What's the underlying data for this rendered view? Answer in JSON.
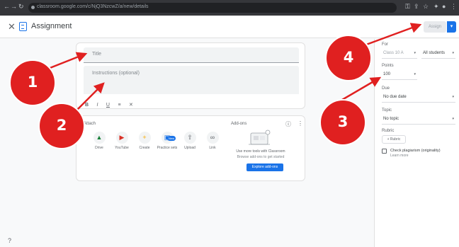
{
  "browser": {
    "url": "classroom.google.com/c/NjQ3NzcwZ/a/new/details"
  },
  "header": {
    "close_icon": "close-icon",
    "title": "Assignment",
    "assign_label": "Assign"
  },
  "editor": {
    "title_placeholder": "Title",
    "instructions_placeholder": "Instructions (optional)",
    "format_labels": [
      "B",
      "I",
      "U",
      "≡",
      "✕"
    ]
  },
  "attach": {
    "heading": "Attach",
    "items": [
      {
        "label": "Drive",
        "icon": "drive-icon"
      },
      {
        "label": "YouTube",
        "icon": "youtube-icon"
      },
      {
        "label": "Create",
        "icon": "create-icon"
      },
      {
        "label": "Practice sets",
        "icon": "practice-sets-icon"
      },
      {
        "label": "Upload",
        "icon": "upload-icon"
      },
      {
        "label": "Link",
        "icon": "link-icon"
      }
    ],
    "new_badge": "New",
    "addons_label": "Add-ons",
    "addons_line1": "Use more tools with Classroom",
    "addons_line2": "Browse add-ons to get started",
    "addons_button": "Explore add-ons"
  },
  "sidebar": {
    "for_label": "For",
    "for_class": "Class 10 A",
    "for_students": "All students",
    "points_label": "Points",
    "points_value": "100",
    "due_label": "Due",
    "due_value": "No due date",
    "topic_label": "Topic",
    "topic_value": "No topic",
    "rubric_label": "Rubric",
    "rubric_button": "+ Rubric",
    "originality_label": "Check plagiarism (originality)",
    "originality_sub": "Learn more"
  },
  "callouts": [
    "1",
    "2",
    "3",
    "4"
  ],
  "colors": {
    "accent": "#1a73e8",
    "callout": "#e02020"
  }
}
